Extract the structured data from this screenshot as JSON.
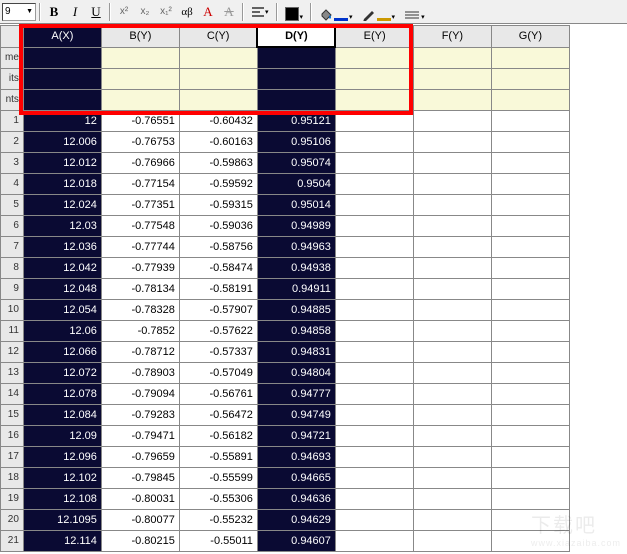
{
  "toolbar": {
    "font_size": "9",
    "bold": "B",
    "italic": "I",
    "underline": "U",
    "sup1": "x²",
    "sup2": "x₂",
    "sup3": "x₁²",
    "greek": "αβ",
    "Aplain": "A",
    "Astrike": "A",
    "fill_color": "#000000",
    "font_color": "#0033cc",
    "line_color": "#cc9900"
  },
  "columns": [
    {
      "label": "A(X)",
      "selected": true
    },
    {
      "label": "B(Y)",
      "selected": false
    },
    {
      "label": "C(Y)",
      "selected": false
    },
    {
      "label": "D(Y)",
      "selected": true,
      "active": true
    },
    {
      "label": "E(Y)",
      "selected": false
    },
    {
      "label": "F(Y)",
      "selected": false
    },
    {
      "label": "G(Y)",
      "selected": false
    }
  ],
  "header_rows": [
    "me",
    "its",
    "nts"
  ],
  "chart_data": {
    "type": "table",
    "title": "",
    "columns": [
      "A(X)",
      "B(Y)",
      "C(Y)",
      "D(Y)"
    ],
    "rows": [
      {
        "n": 1,
        "a": "12",
        "b": "-0.76551",
        "c": "-0.60432",
        "d": "0.95121"
      },
      {
        "n": 2,
        "a": "12.006",
        "b": "-0.76753",
        "c": "-0.60163",
        "d": "0.95106"
      },
      {
        "n": 3,
        "a": "12.012",
        "b": "-0.76966",
        "c": "-0.59863",
        "d": "0.95074"
      },
      {
        "n": 4,
        "a": "12.018",
        "b": "-0.77154",
        "c": "-0.59592",
        "d": "0.9504"
      },
      {
        "n": 5,
        "a": "12.024",
        "b": "-0.77351",
        "c": "-0.59315",
        "d": "0.95014"
      },
      {
        "n": 6,
        "a": "12.03",
        "b": "-0.77548",
        "c": "-0.59036",
        "d": "0.94989"
      },
      {
        "n": 7,
        "a": "12.036",
        "b": "-0.77744",
        "c": "-0.58756",
        "d": "0.94963"
      },
      {
        "n": 8,
        "a": "12.042",
        "b": "-0.77939",
        "c": "-0.58474",
        "d": "0.94938"
      },
      {
        "n": 9,
        "a": "12.048",
        "b": "-0.78134",
        "c": "-0.58191",
        "d": "0.94911"
      },
      {
        "n": 10,
        "a": "12.054",
        "b": "-0.78328",
        "c": "-0.57907",
        "d": "0.94885"
      },
      {
        "n": 11,
        "a": "12.06",
        "b": "-0.7852",
        "c": "-0.57622",
        "d": "0.94858"
      },
      {
        "n": 12,
        "a": "12.066",
        "b": "-0.78712",
        "c": "-0.57337",
        "d": "0.94831"
      },
      {
        "n": 13,
        "a": "12.072",
        "b": "-0.78903",
        "c": "-0.57049",
        "d": "0.94804"
      },
      {
        "n": 14,
        "a": "12.078",
        "b": "-0.79094",
        "c": "-0.56761",
        "d": "0.94777"
      },
      {
        "n": 15,
        "a": "12.084",
        "b": "-0.79283",
        "c": "-0.56472",
        "d": "0.94749"
      },
      {
        "n": 16,
        "a": "12.09",
        "b": "-0.79471",
        "c": "-0.56182",
        "d": "0.94721"
      },
      {
        "n": 17,
        "a": "12.096",
        "b": "-0.79659",
        "c": "-0.55891",
        "d": "0.94693"
      },
      {
        "n": 18,
        "a": "12.102",
        "b": "-0.79845",
        "c": "-0.55599",
        "d": "0.94665"
      },
      {
        "n": 19,
        "a": "12.108",
        "b": "-0.80031",
        "c": "-0.55306",
        "d": "0.94636"
      },
      {
        "n": 20,
        "a": "12.1095",
        "b": "-0.80077",
        "c": "-0.55232",
        "d": "0.94629"
      },
      {
        "n": 21,
        "a": "12.114",
        "b": "-0.80215",
        "c": "-0.55011",
        "d": "0.94607"
      }
    ]
  },
  "watermark": {
    "main": "下载吧",
    "sub": "www.xiazaiba.com"
  }
}
